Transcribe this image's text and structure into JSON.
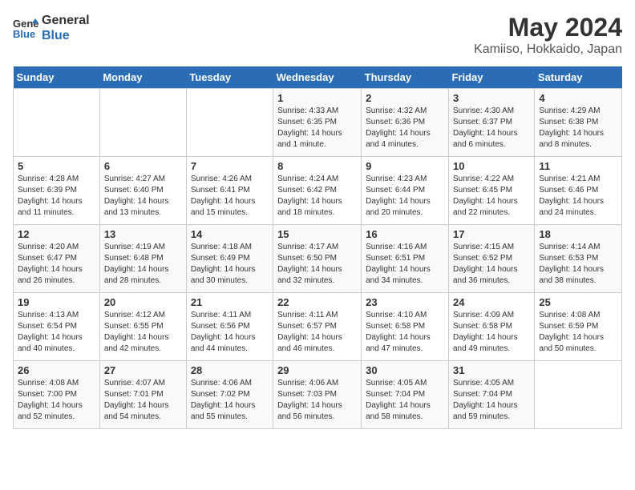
{
  "logo": {
    "line1": "General",
    "line2": "Blue"
  },
  "title": "May 2024",
  "subtitle": "Kamiiso, Hokkaido, Japan",
  "days_of_week": [
    "Sunday",
    "Monday",
    "Tuesday",
    "Wednesday",
    "Thursday",
    "Friday",
    "Saturday"
  ],
  "weeks": [
    [
      {
        "day": null,
        "content": null
      },
      {
        "day": null,
        "content": null
      },
      {
        "day": null,
        "content": null
      },
      {
        "day": "1",
        "content": "Sunrise: 4:33 AM\nSunset: 6:35 PM\nDaylight: 14 hours\nand 1 minute."
      },
      {
        "day": "2",
        "content": "Sunrise: 4:32 AM\nSunset: 6:36 PM\nDaylight: 14 hours\nand 4 minutes."
      },
      {
        "day": "3",
        "content": "Sunrise: 4:30 AM\nSunset: 6:37 PM\nDaylight: 14 hours\nand 6 minutes."
      },
      {
        "day": "4",
        "content": "Sunrise: 4:29 AM\nSunset: 6:38 PM\nDaylight: 14 hours\nand 8 minutes."
      }
    ],
    [
      {
        "day": "5",
        "content": "Sunrise: 4:28 AM\nSunset: 6:39 PM\nDaylight: 14 hours\nand 11 minutes."
      },
      {
        "day": "6",
        "content": "Sunrise: 4:27 AM\nSunset: 6:40 PM\nDaylight: 14 hours\nand 13 minutes."
      },
      {
        "day": "7",
        "content": "Sunrise: 4:26 AM\nSunset: 6:41 PM\nDaylight: 14 hours\nand 15 minutes."
      },
      {
        "day": "8",
        "content": "Sunrise: 4:24 AM\nSunset: 6:42 PM\nDaylight: 14 hours\nand 18 minutes."
      },
      {
        "day": "9",
        "content": "Sunrise: 4:23 AM\nSunset: 6:44 PM\nDaylight: 14 hours\nand 20 minutes."
      },
      {
        "day": "10",
        "content": "Sunrise: 4:22 AM\nSunset: 6:45 PM\nDaylight: 14 hours\nand 22 minutes."
      },
      {
        "day": "11",
        "content": "Sunrise: 4:21 AM\nSunset: 6:46 PM\nDaylight: 14 hours\nand 24 minutes."
      }
    ],
    [
      {
        "day": "12",
        "content": "Sunrise: 4:20 AM\nSunset: 6:47 PM\nDaylight: 14 hours\nand 26 minutes."
      },
      {
        "day": "13",
        "content": "Sunrise: 4:19 AM\nSunset: 6:48 PM\nDaylight: 14 hours\nand 28 minutes."
      },
      {
        "day": "14",
        "content": "Sunrise: 4:18 AM\nSunset: 6:49 PM\nDaylight: 14 hours\nand 30 minutes."
      },
      {
        "day": "15",
        "content": "Sunrise: 4:17 AM\nSunset: 6:50 PM\nDaylight: 14 hours\nand 32 minutes."
      },
      {
        "day": "16",
        "content": "Sunrise: 4:16 AM\nSunset: 6:51 PM\nDaylight: 14 hours\nand 34 minutes."
      },
      {
        "day": "17",
        "content": "Sunrise: 4:15 AM\nSunset: 6:52 PM\nDaylight: 14 hours\nand 36 minutes."
      },
      {
        "day": "18",
        "content": "Sunrise: 4:14 AM\nSunset: 6:53 PM\nDaylight: 14 hours\nand 38 minutes."
      }
    ],
    [
      {
        "day": "19",
        "content": "Sunrise: 4:13 AM\nSunset: 6:54 PM\nDaylight: 14 hours\nand 40 minutes."
      },
      {
        "day": "20",
        "content": "Sunrise: 4:12 AM\nSunset: 6:55 PM\nDaylight: 14 hours\nand 42 minutes."
      },
      {
        "day": "21",
        "content": "Sunrise: 4:11 AM\nSunset: 6:56 PM\nDaylight: 14 hours\nand 44 minutes."
      },
      {
        "day": "22",
        "content": "Sunrise: 4:11 AM\nSunset: 6:57 PM\nDaylight: 14 hours\nand 46 minutes."
      },
      {
        "day": "23",
        "content": "Sunrise: 4:10 AM\nSunset: 6:58 PM\nDaylight: 14 hours\nand 47 minutes."
      },
      {
        "day": "24",
        "content": "Sunrise: 4:09 AM\nSunset: 6:58 PM\nDaylight: 14 hours\nand 49 minutes."
      },
      {
        "day": "25",
        "content": "Sunrise: 4:08 AM\nSunset: 6:59 PM\nDaylight: 14 hours\nand 50 minutes."
      }
    ],
    [
      {
        "day": "26",
        "content": "Sunrise: 4:08 AM\nSunset: 7:00 PM\nDaylight: 14 hours\nand 52 minutes."
      },
      {
        "day": "27",
        "content": "Sunrise: 4:07 AM\nSunset: 7:01 PM\nDaylight: 14 hours\nand 54 minutes."
      },
      {
        "day": "28",
        "content": "Sunrise: 4:06 AM\nSunset: 7:02 PM\nDaylight: 14 hours\nand 55 minutes."
      },
      {
        "day": "29",
        "content": "Sunrise: 4:06 AM\nSunset: 7:03 PM\nDaylight: 14 hours\nand 56 minutes."
      },
      {
        "day": "30",
        "content": "Sunrise: 4:05 AM\nSunset: 7:04 PM\nDaylight: 14 hours\nand 58 minutes."
      },
      {
        "day": "31",
        "content": "Sunrise: 4:05 AM\nSunset: 7:04 PM\nDaylight: 14 hours\nand 59 minutes."
      },
      {
        "day": null,
        "content": null
      }
    ]
  ]
}
